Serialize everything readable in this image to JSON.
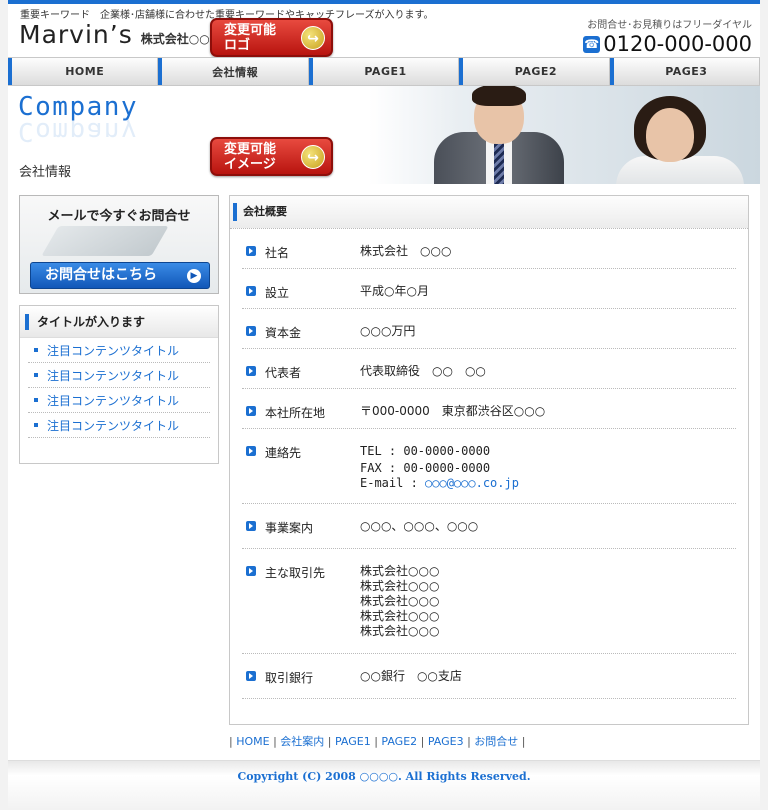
{
  "header": {
    "tagline": "重要キーワード　企業様･店舗様に合わせた重要キーワードやキャッチフレーズが入ります。",
    "logo_main": "Marvin’s",
    "logo_company": "株式会社○○○",
    "logo_badge": [
      "変更可能",
      "ロゴ"
    ],
    "contact_label": "お問合せ･お見積りはフリーダイヤル",
    "phone": "0120-000-000",
    "phone_icon": "phone-icon"
  },
  "nav": [
    "HOME",
    "会社情報",
    "PAGE1",
    "PAGE2",
    "PAGE3"
  ],
  "hero": {
    "title": "Company",
    "subtitle": "会社情報",
    "badge": [
      "変更可能",
      "イメージ"
    ]
  },
  "sidebar": {
    "mail_title": "メールで今すぐお問合せ",
    "mail_button": "お問合せはこちら",
    "box_title": "タイトルが入ります",
    "items": [
      "注目コンテンツタイトル",
      "注目コンテンツタイトル",
      "注目コンテンツタイトル",
      "注目コンテンツタイトル"
    ]
  },
  "main": {
    "heading": "会社概要",
    "rows": [
      {
        "label": "社名",
        "value": "株式会社　○○○"
      },
      {
        "label": "設立",
        "value": "平成○年○月"
      },
      {
        "label": "資本金",
        "value": "○○○万円"
      },
      {
        "label": "代表者",
        "value": "代表取締役　○○　○○"
      },
      {
        "label": "本社所在地",
        "value": "〒000-0000　東京都渋谷区○○○"
      },
      {
        "label": "連絡先",
        "tel": "TEL : 00-0000-0000",
        "fax": "FAX : 00-0000-0000",
        "email_label": "E-mail : ",
        "email": "○○○@○○○.co.jp"
      },
      {
        "label": "事業案内",
        "value": "○○○、○○○、○○○"
      },
      {
        "label": "主な取引先",
        "lines": [
          "株式会社○○○",
          "株式会社○○○",
          "株式会社○○○",
          "株式会社○○○",
          "株式会社○○○"
        ]
      },
      {
        "label": "取引銀行",
        "value": "○○銀行　○○支店"
      }
    ]
  },
  "footer": {
    "links": [
      "HOME",
      "会社案内",
      "PAGE1",
      "PAGE2",
      "PAGE3",
      "お問合せ"
    ],
    "copyright": "Copyright (C) 2008 ○○○○. All Rights Reserved."
  },
  "colors": {
    "accent": "#1b6fd1",
    "badge_red": "#c8201a"
  }
}
